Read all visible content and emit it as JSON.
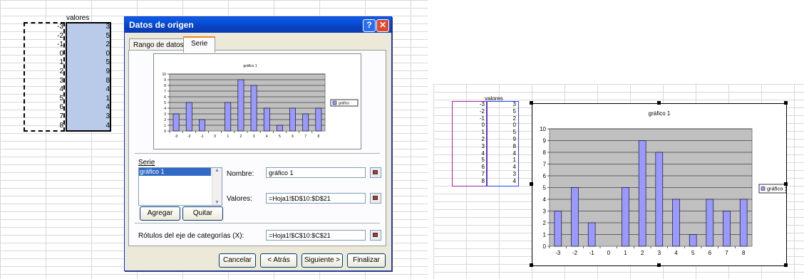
{
  "left_sheet": {
    "header": "valores",
    "x_values": [
      "-3",
      "-2",
      "-1",
      "0",
      "1",
      "2",
      "3",
      "4",
      "5",
      "6",
      "7",
      "8"
    ],
    "y_values": [
      "3",
      "5",
      "2",
      "0",
      "5",
      "9",
      "8",
      "4",
      "1",
      "4",
      "3",
      "4"
    ]
  },
  "dialog": {
    "title": "Datos de origen",
    "tabs": [
      {
        "label": "Rango de datos"
      },
      {
        "label": "Serie"
      }
    ],
    "serie_label": "Serie",
    "series_list": [
      "gráfico 1"
    ],
    "nombre_label": "Nombre:",
    "nombre_value": "gráfico 1",
    "valores_label": "Valores:",
    "valores_value": "=Hoja1!$D$10:$D$21",
    "rotulos_label": "Rótulos del eje de categorías (X):",
    "rotulos_value": "=Hoja1!$C$10:$C$21",
    "buttons": {
      "agregar": "Agregar",
      "quitar": "Quitar",
      "cancelar": "Cancelar",
      "atras": "< Atrás",
      "siguiente": "Siguiente >",
      "finalizar": "Finalizar"
    }
  },
  "right_sheet": {
    "header": "valores",
    "x_values": [
      "-3",
      "-2",
      "-1",
      "0",
      "1",
      "2",
      "3",
      "4",
      "5",
      "6",
      "7",
      "8"
    ],
    "y_values": [
      "3",
      "5",
      "2",
      "0",
      "5",
      "9",
      "8",
      "4",
      "1",
      "4",
      "3",
      "4"
    ]
  },
  "chart_data": [
    {
      "type": "bar",
      "title": "gráfico 1",
      "categories": [
        "-3",
        "-2",
        "-1",
        "0",
        "1",
        "2",
        "3",
        "4",
        "5",
        "6",
        "7",
        "8"
      ],
      "series": [
        {
          "name": "gráfico",
          "values": [
            3,
            5,
            2,
            0,
            5,
            9,
            8,
            4,
            1,
            4,
            3,
            4
          ]
        }
      ],
      "ylim": [
        0,
        10
      ],
      "grid": true,
      "legend": "right",
      "colors": {
        "bar": "#9999ff",
        "plot_bg": "#c0c0c0"
      }
    },
    {
      "type": "bar",
      "title": "gráfico 1",
      "categories": [
        "-3",
        "-2",
        "-1",
        "0",
        "1",
        "2",
        "3",
        "4",
        "5",
        "6",
        "7",
        "8"
      ],
      "series": [
        {
          "name": "gráfico 1",
          "values": [
            3,
            5,
            2,
            0,
            5,
            9,
            8,
            4,
            1,
            4,
            3,
            4
          ]
        }
      ],
      "ylim": [
        0,
        10
      ],
      "grid": true,
      "legend": "right",
      "colors": {
        "bar": "#9999ff",
        "plot_bg": "#c0c0c0"
      }
    }
  ]
}
